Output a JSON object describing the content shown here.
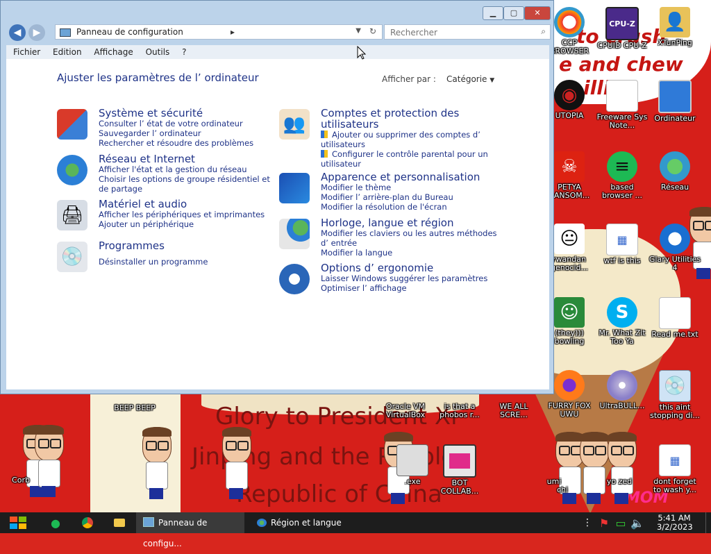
{
  "window": {
    "breadcrumb": "Panneau de configuration",
    "breadcrumb_sep": "▸",
    "search_placeholder": "Rechercher",
    "menu": [
      "Fichier",
      "Edition",
      "Affichage",
      "Outils",
      "?"
    ],
    "heading": "Ajuster les paramètres de l’ ordinateur",
    "view_by_label": "Afficher par :",
    "view_by_value": "Catégorie",
    "categories": [
      {
        "title": "Système et sécurité",
        "links": [
          "Consulter l’ état de votre ordinateur",
          "Sauvegarder l’ ordinateur",
          "Rechercher et résoudre des problèmes"
        ]
      },
      {
        "title": "Réseau et Internet",
        "links": [
          "Afficher l'état et la gestion du réseau",
          "Choisir les options de groupe résidentiel et de partage"
        ]
      },
      {
        "title": "Matériel et audio",
        "links": [
          "Afficher les périphériques et imprimantes",
          "Ajouter un périphérique"
        ]
      },
      {
        "title": "Programmes",
        "links": [
          "Désinstaller un programme"
        ]
      },
      {
        "title": "Comptes et protection des utilisateurs",
        "links": [
          "Ajouter ou supprimer des comptes d’ utilisateurs",
          "Configurer le contrôle parental pour un utilisateur"
        ]
      },
      {
        "title": "Apparence et personnalisation",
        "links": [
          "Modifier le thème",
          "Modifier l’ arrière-plan du Bureau",
          "Modifier la résolution de l'écran"
        ]
      },
      {
        "title": "Horloge, langue et région",
        "links": [
          "Modifier les claviers ou les autres méthodes d’ entrée",
          "Modifier la langue"
        ]
      },
      {
        "title": "Options d’ ergonomie",
        "links": [
          "Laisser Windows suggérer les paramètres",
          "Optimiser l’ affichage"
        ]
      }
    ]
  },
  "wallpaper": {
    "top_text_1": "to crush",
    "top_text_2": "e and chew",
    "top_text_3": "illi",
    "mid_text_1": "Glory to President Xi",
    "mid_text_2": "Jinping and the People",
    "mid_text_3": "Republic of China",
    "bottom_right_text": "MOM"
  },
  "desktop_icons": [
    {
      "label": "CCP BROWSER",
      "icon": "browser-icon"
    },
    {
      "label": "CPUID CPU-Z",
      "icon": "cpuz-icon",
      "badge": "CPU-Z"
    },
    {
      "label": "XTunPing",
      "icon": "user-folder-icon"
    },
    {
      "label": "UTOPIA",
      "icon": "utopia-icon"
    },
    {
      "label": "Freeware Sys Note...",
      "icon": "document-icon"
    },
    {
      "label": "Ordinateur",
      "icon": "computer-icon"
    },
    {
      "label": "PETYA RANSOM...",
      "icon": "skull-icon"
    },
    {
      "label": "based browser ...",
      "icon": "spotify-icon"
    },
    {
      "label": "Réseau",
      "icon": "network-icon"
    },
    {
      "label": "rwandan genocid...",
      "icon": "meme-icon"
    },
    {
      "label": "wtf is this",
      "icon": "file-icon"
    },
    {
      "label": "Glary Utilities 4",
      "icon": "glary-icon"
    },
    {
      "label": "(they))) bowling",
      "icon": "santa-icon"
    },
    {
      "label": "Mr. What Zit Too Ya",
      "icon": "skype-icon"
    },
    {
      "label": "Read me.txt",
      "icon": "textfile-icon"
    },
    {
      "label": "FURRY FOX UWU",
      "icon": "firefox-icon"
    },
    {
      "label": "UltraBULL...",
      "icon": "disc-icon"
    },
    {
      "label": "this aint stopping di...",
      "icon": "setup-icon"
    },
    {
      "label": "BEEP BEEP",
      "icon": "shortcut-icon"
    },
    {
      "label": "Oracle VM VirtualBox",
      "icon": "virtualbox-icon"
    },
    {
      "label": "is that a phobos r...",
      "icon": "shortcut-icon"
    },
    {
      "label": "WE ALL SCRE...",
      "icon": "shortcut-icon"
    },
    {
      "label": ".exe",
      "icon": "exe-icon"
    },
    {
      "label": "BOT COLLAB...",
      "icon": "monitor-icon"
    },
    {
      "label": "dont forget to wash y...",
      "icon": "file-icon"
    },
    {
      "label": "Corb",
      "icon": "recycle-icon"
    },
    {
      "label": "umi",
      "icon": "shortcut-icon"
    },
    {
      "label": "yo zed",
      "icon": "shortcut-icon"
    },
    {
      "label": "chi",
      "icon": "shortcut-icon"
    }
  ],
  "taskbar": {
    "tasks": [
      {
        "label": "Panneau de configu...",
        "icon": "control-panel-icon"
      },
      {
        "label": "Région et langue",
        "icon": "region-icon"
      }
    ],
    "time": "5:41 AM",
    "date": "3/2/2023"
  },
  "colors": {
    "link_blue": "#1e3287",
    "window_frame": "#bcd3ea",
    "taskbar": "#1d1d1d",
    "wallpaper_red": "#d61f1a"
  }
}
